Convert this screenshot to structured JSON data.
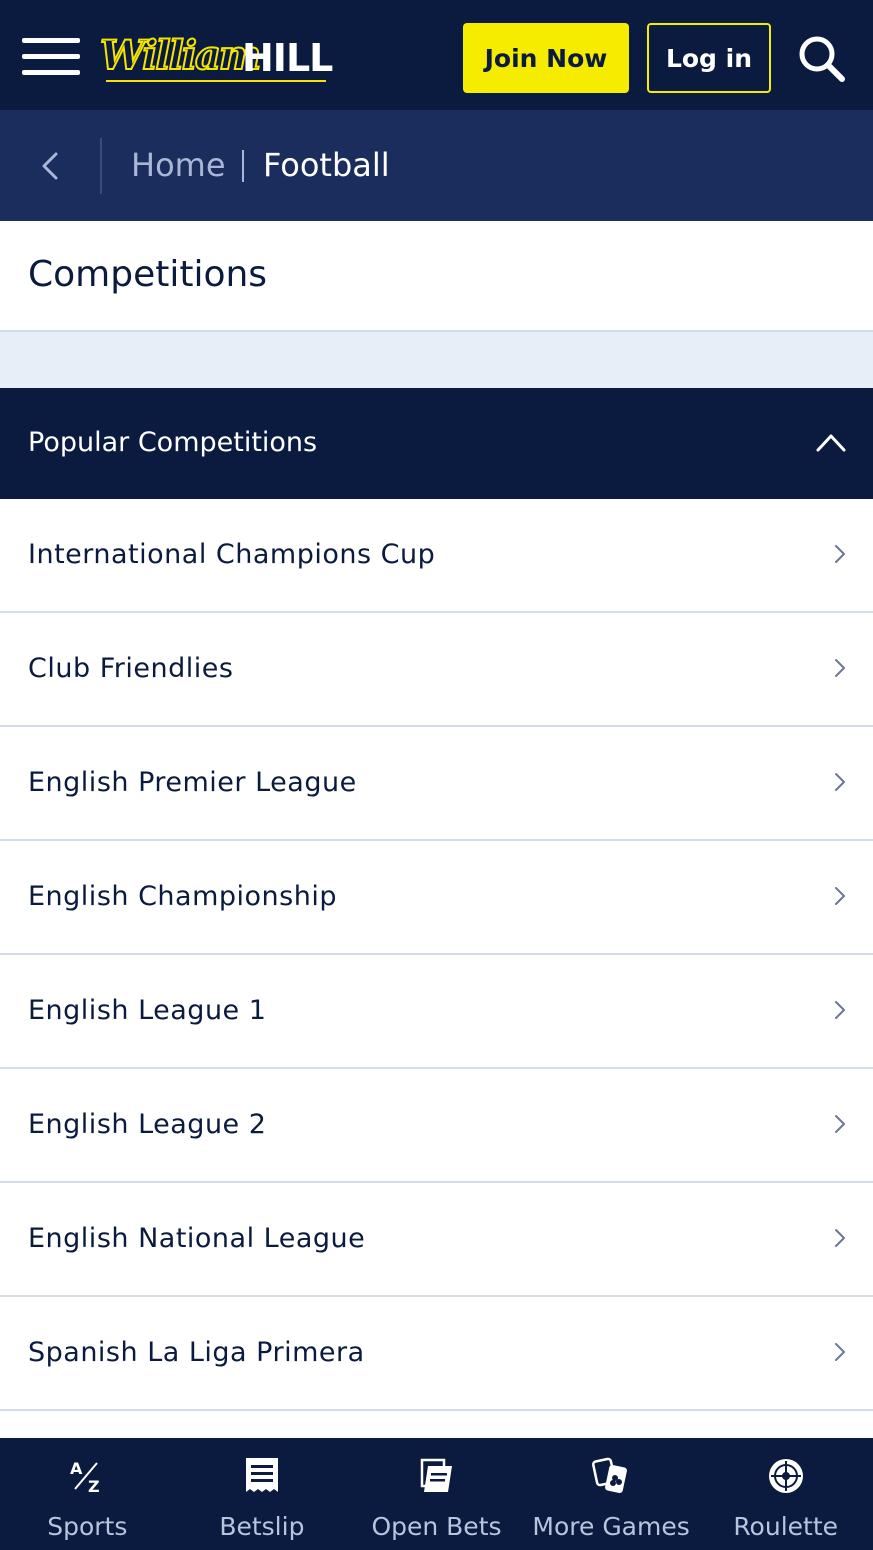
{
  "header": {
    "logo_script": "William",
    "logo_block": "HILL",
    "join_label": "Join Now",
    "login_label": "Log in"
  },
  "breadcrumb": {
    "home": "Home",
    "current": "Football"
  },
  "page": {
    "title": "Competitions"
  },
  "section": {
    "title": "Popular Competitions"
  },
  "competitions": [
    {
      "label": "International Champions Cup"
    },
    {
      "label": "Club Friendlies"
    },
    {
      "label": "English Premier League"
    },
    {
      "label": "English Championship"
    },
    {
      "label": "English League 1"
    },
    {
      "label": "English League 2"
    },
    {
      "label": "English National League"
    },
    {
      "label": "Spanish La Liga Primera"
    }
  ],
  "bottom_nav": [
    {
      "label": "Sports",
      "icon": "az-icon"
    },
    {
      "label": "Betslip",
      "icon": "receipt-icon"
    },
    {
      "label": "Open Bets",
      "icon": "tickets-icon"
    },
    {
      "label": "More Games",
      "icon": "cards-icon"
    },
    {
      "label": "Roulette",
      "icon": "roulette-icon"
    }
  ],
  "colors": {
    "navy": "#0b1a3f",
    "breadcrumb_bg": "#1b2d5c",
    "accent_yellow": "#f6ec00",
    "divider": "#d4dcea",
    "spacer_bg": "#e8eef8"
  }
}
